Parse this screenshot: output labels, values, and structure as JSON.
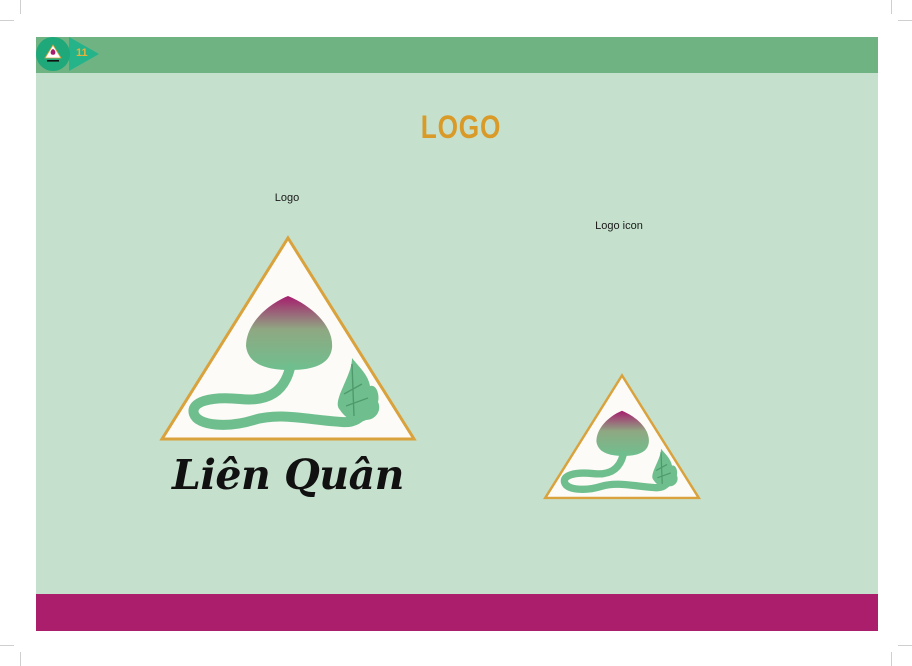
{
  "header": {
    "page_number": "11",
    "badge_icon": "lotus-triangle-icon",
    "bar_color": "#6fb383",
    "badge_color": "#1fa879"
  },
  "title": "LOGO",
  "labels": {
    "logo": "Logo",
    "logo_icon": "Logo icon"
  },
  "brand": {
    "name": "Liên Quân",
    "logo_icon": "lotus-triangle-icon"
  },
  "colors": {
    "background": "#c5e0cc",
    "title": "#d99a28",
    "footer": "#aa1e6b",
    "triangle_border": "#d9a23c",
    "lotus_green": "#6fbf8e",
    "lotus_magenta": "#a61d6e"
  }
}
